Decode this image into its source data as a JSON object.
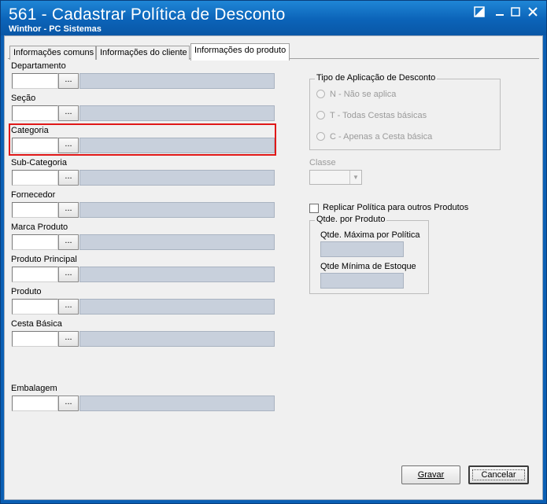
{
  "window": {
    "title": "561 - Cadastrar Política de Desconto",
    "subtitle": "Winthor - PC Sistemas",
    "controls": [
      "restore-icon",
      "minimize-icon",
      "maximize-icon",
      "close-icon"
    ]
  },
  "tabs": [
    {
      "label": "Informações comuns",
      "active": false
    },
    {
      "label": "Informações do cliente",
      "active": false
    },
    {
      "label": "Informações do produto",
      "active": true
    }
  ],
  "fields": [
    {
      "label": "Departamento",
      "button": "..."
    },
    {
      "label": "Seção",
      "button": "..."
    },
    {
      "label": "Categoria",
      "button": "..."
    },
    {
      "label": "Sub-Categoria",
      "button": "..."
    },
    {
      "label": "Fornecedor",
      "button": "..."
    },
    {
      "label": "Marca Produto",
      "button": "..."
    },
    {
      "label": "Produto Principal",
      "button": "..."
    },
    {
      "label": "Produto",
      "button": "..."
    },
    {
      "label": "Cesta Básica",
      "button": "..."
    },
    {
      "label": "Embalagem",
      "button": "..."
    }
  ],
  "highlight": {
    "color": "#e01818"
  },
  "tipo_aplicacao": {
    "title": "Tipo de Aplicação de Desconto",
    "options": [
      "N - Não se aplica",
      "T - Todas Cestas básicas",
      "C - Apenas a Cesta básica"
    ]
  },
  "classe": {
    "label": "Classe",
    "value": ""
  },
  "replicar": {
    "label": "Replicar Política para outros Produtos",
    "checked": false
  },
  "qtde": {
    "title": "Qtde. por Produto",
    "max_label": "Qtde. Máxima por Política",
    "min_label": "Qtde Mínima de Estoque"
  },
  "buttons": {
    "gravar": "Gravar",
    "cancelar": "Cancelar"
  }
}
